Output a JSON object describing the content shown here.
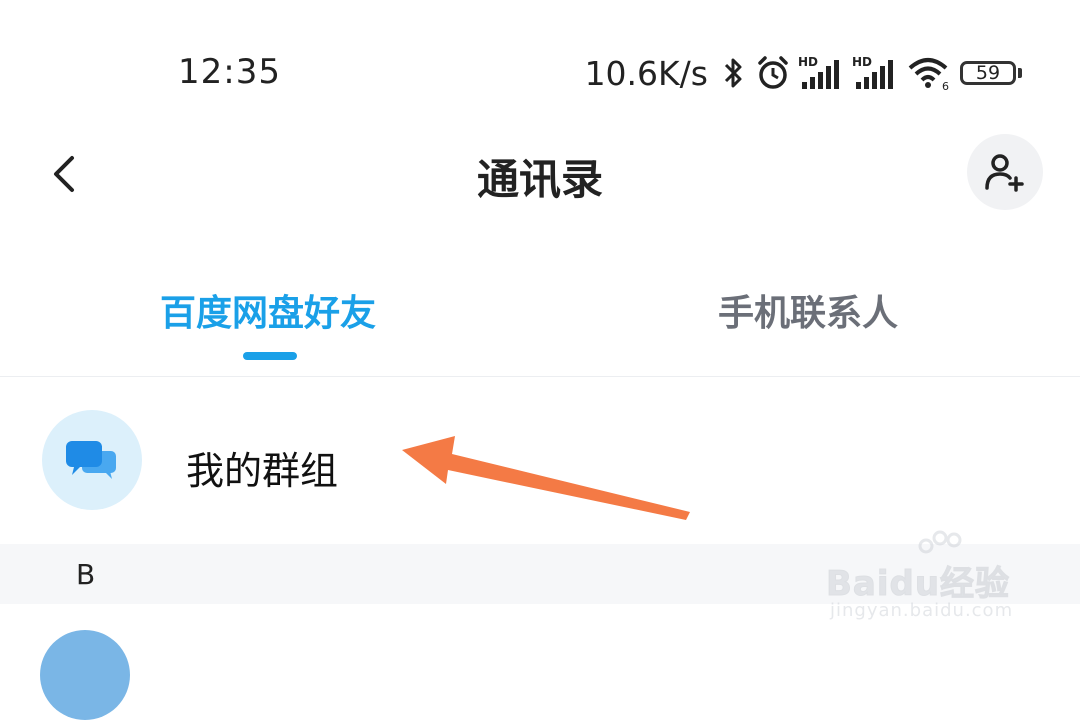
{
  "status_bar": {
    "time": "12:35",
    "net_speed": "10.6K/s",
    "icons": [
      "bluetooth-icon",
      "alarm-icon",
      "signal-hd-icon",
      "signal-hd-icon",
      "wifi-icon"
    ],
    "battery": "59"
  },
  "nav": {
    "title": "通讯录",
    "back_icon": "chevron-left-icon",
    "add_icon": "add-person-icon"
  },
  "tabs": [
    {
      "label": "百度网盘好友",
      "active": true
    },
    {
      "label": "手机联系人",
      "active": false
    }
  ],
  "colors": {
    "accent": "#1aa0e8",
    "annotation_arrow": "#f47a45",
    "avatar_bg": "#dcf0fb",
    "section_bg": "#f6f7f9"
  },
  "group_row": {
    "label": "我的群组",
    "icon": "chat-bubbles-icon"
  },
  "section": {
    "letter": "B"
  },
  "watermark": {
    "brand": "Baidu经验",
    "url": "jingyan.baidu.com"
  }
}
